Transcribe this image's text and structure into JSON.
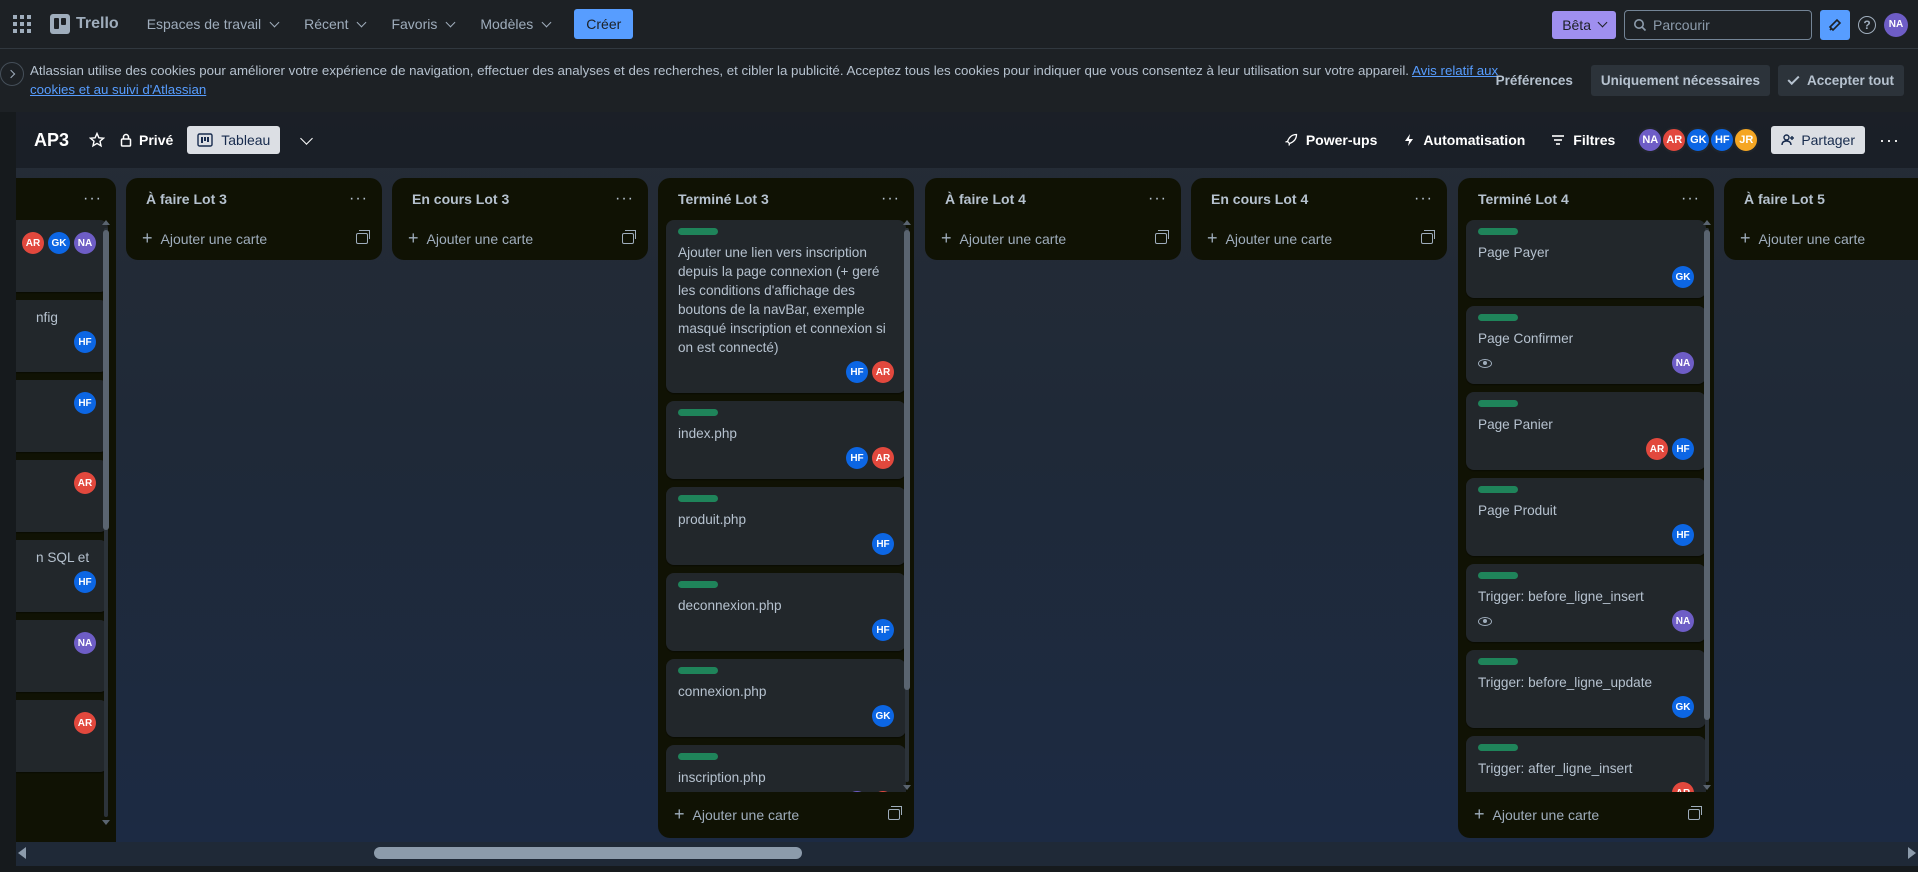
{
  "colors": {
    "nav_bg": "#1d2125",
    "accent": "#579dff",
    "beta": "#9f8fef",
    "list_bg": "#101204",
    "card_bg": "#22272b",
    "label_green": "#1f845a"
  },
  "topnav": {
    "app_name": "Trello",
    "menus": [
      "Espaces de travail",
      "Récent",
      "Favoris",
      "Modèles"
    ],
    "create_label": "Créer",
    "beta_label": "Bêta",
    "search_placeholder": "Parcourir",
    "user_initials": "NA",
    "help_label": "?"
  },
  "cookie": {
    "text": "Atlassian utilise des cookies pour améliorer votre expérience de navigation, effectuer des analyses et des recherches, et cibler la publicité. Acceptez tous les cookies pour indiquer que vous consentez à leur utilisation sur votre appareil.",
    "link": "Avis relatif aux cookies et au suivi d'Atlassian",
    "preferences": "Préférences",
    "necessary": "Uniquement nécessaires",
    "accept": "Accepter tout"
  },
  "board": {
    "title": "AP3",
    "visibility": "Privé",
    "view": "Tableau",
    "powerups": "Power-ups",
    "automation": "Automatisation",
    "filters": "Filtres",
    "share": "Partager",
    "members": [
      {
        "initials": "NA",
        "color": "#6e5dc6"
      },
      {
        "initials": "AR",
        "color": "#e2483d"
      },
      {
        "initials": "GK",
        "color": "#0c66e4"
      },
      {
        "initials": "HF",
        "color": "#0c66e4"
      },
      {
        "initials": "JR",
        "color": "#f5a623"
      }
    ]
  },
  "lists": {
    "partial": {
      "name": "",
      "add_label": "",
      "cards": [
        {
          "title": "",
          "avatars": [
            {
              "i": "AR",
              "c": "#e2483d"
            },
            {
              "i": "GK",
              "c": "#0c66e4"
            },
            {
              "i": "NA",
              "c": "#6e5dc6"
            }
          ]
        },
        {
          "title": "nfig",
          "avatars": [
            {
              "i": "HF",
              "c": "#0c66e4"
            }
          ]
        },
        {
          "title": "",
          "avatars": [
            {
              "i": "HF",
              "c": "#0c66e4"
            }
          ]
        },
        {
          "title": "",
          "avatars": [
            {
              "i": "AR",
              "c": "#e2483d"
            }
          ]
        },
        {
          "title": "n SQL et",
          "avatars": [
            {
              "i": "HF",
              "c": "#0c66e4"
            }
          ]
        },
        {
          "title": "",
          "avatars": [
            {
              "i": "NA",
              "c": "#6e5dc6"
            }
          ]
        },
        {
          "title": "",
          "avatars": [
            {
              "i": "AR",
              "c": "#e2483d"
            }
          ]
        }
      ]
    },
    "afaire3": {
      "name": "À faire Lot 3",
      "add_label": "Ajouter une carte"
    },
    "encours3": {
      "name": "En cours Lot 3",
      "add_label": "Ajouter une carte"
    },
    "termine3": {
      "name": "Terminé Lot 3",
      "add_label": "Ajouter une carte",
      "cards": [
        {
          "title": "Ajouter une lien vers inscription depuis la page connexion (+ geré les conditions d'affichage des boutons de la navBar, exemple masqué inscription et connexion si on est connecté)",
          "watch": false,
          "avatars": [
            {
              "i": "HF",
              "c": "#0c66e4"
            },
            {
              "i": "AR",
              "c": "#e2483d"
            }
          ]
        },
        {
          "title": "index.php",
          "watch": false,
          "avatars": [
            {
              "i": "HF",
              "c": "#0c66e4"
            },
            {
              "i": "AR",
              "c": "#e2483d"
            }
          ]
        },
        {
          "title": "produit.php",
          "watch": false,
          "avatars": [
            {
              "i": "HF",
              "c": "#0c66e4"
            }
          ]
        },
        {
          "title": "deconnexion.php",
          "watch": false,
          "avatars": [
            {
              "i": "HF",
              "c": "#0c66e4"
            }
          ]
        },
        {
          "title": "connexion.php",
          "watch": false,
          "avatars": [
            {
              "i": "GK",
              "c": "#0c66e4"
            }
          ]
        },
        {
          "title": "inscription.php",
          "watch": true,
          "avatars": [
            {
              "i": "NA",
              "c": "#6e5dc6"
            },
            {
              "i": "AR",
              "c": "#e2483d"
            }
          ]
        }
      ]
    },
    "afaire4": {
      "name": "À faire Lot 4",
      "add_label": "Ajouter une carte"
    },
    "encours4": {
      "name": "En cours Lot 4",
      "add_label": "Ajouter une carte"
    },
    "termine4": {
      "name": "Terminé Lot 4",
      "add_label": "Ajouter une carte",
      "cards": [
        {
          "title": "Page Payer",
          "watch": false,
          "avatars": [
            {
              "i": "GK",
              "c": "#0c66e4"
            }
          ]
        },
        {
          "title": "Page Confirmer",
          "watch": true,
          "avatars": [
            {
              "i": "NA",
              "c": "#6e5dc6"
            }
          ]
        },
        {
          "title": "Page Panier",
          "watch": false,
          "avatars": [
            {
              "i": "AR",
              "c": "#e2483d"
            },
            {
              "i": "HF",
              "c": "#0c66e4"
            }
          ]
        },
        {
          "title": "Page Produit",
          "watch": false,
          "avatars": [
            {
              "i": "HF",
              "c": "#0c66e4"
            }
          ]
        },
        {
          "title": "Trigger: before_ligne_insert",
          "watch": true,
          "avatars": [
            {
              "i": "NA",
              "c": "#6e5dc6"
            }
          ]
        },
        {
          "title": "Trigger: before_ligne_update",
          "watch": false,
          "avatars": [
            {
              "i": "GK",
              "c": "#0c66e4"
            }
          ]
        },
        {
          "title": "Trigger: after_ligne_insert",
          "watch": false,
          "avatars": [
            {
              "i": "AR",
              "c": "#e2483d"
            }
          ]
        }
      ]
    },
    "afaire5": {
      "name": "À faire Lot 5",
      "add_label": "Ajouter une carte"
    }
  }
}
